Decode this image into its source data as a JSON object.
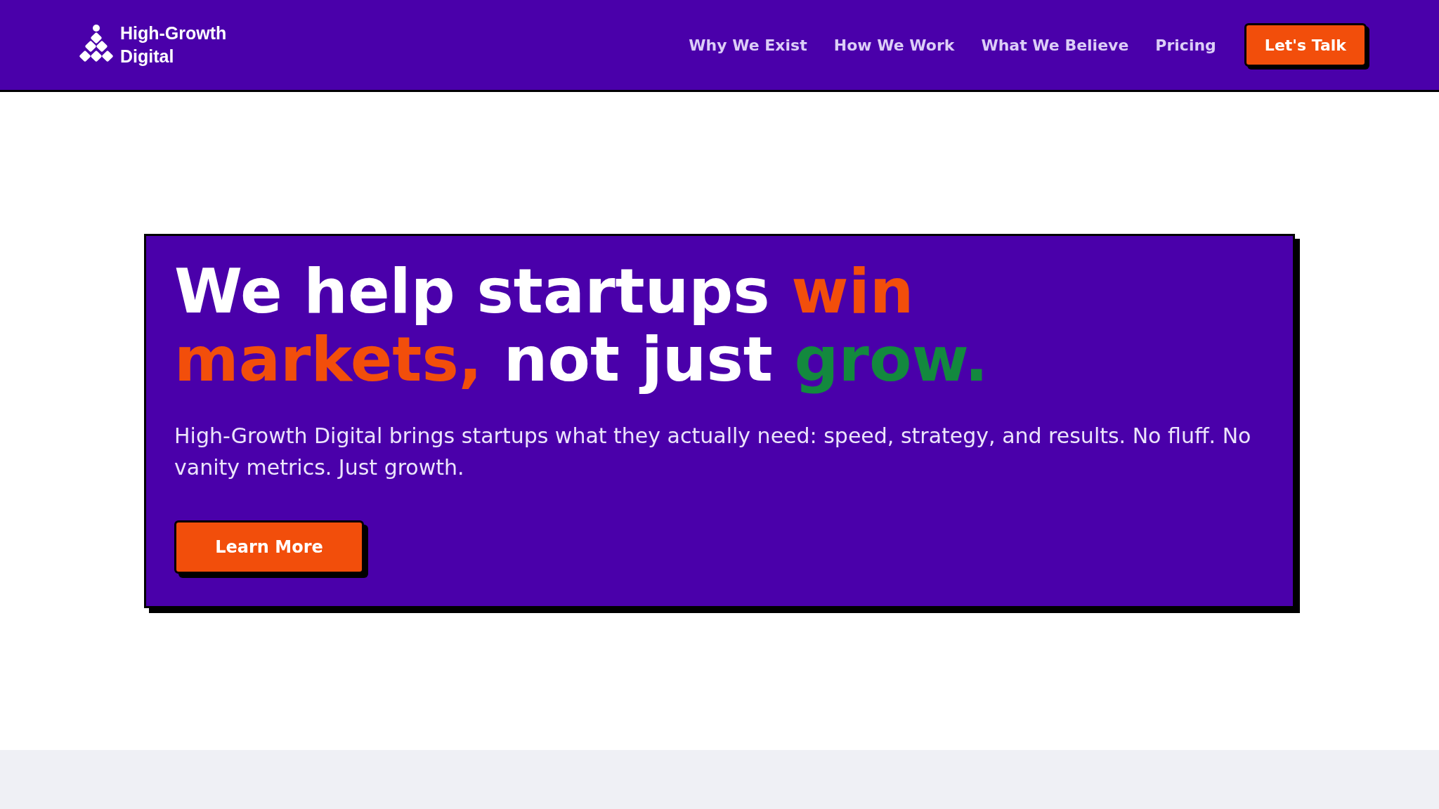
{
  "header": {
    "logo": {
      "line_1": "High-Growth",
      "line_2": "Digital"
    },
    "nav": [
      {
        "label": "Why We Exist"
      },
      {
        "label": "How We Work"
      },
      {
        "label": "What We Believe"
      },
      {
        "label": "Pricing"
      }
    ],
    "cta": "Let's Talk"
  },
  "hero": {
    "headline": [
      {
        "text": "We help startups ",
        "color": "#ffffff"
      },
      {
        "text": "win markets,",
        "color": "#f24e0b"
      },
      {
        "text": " not just ",
        "color": "#ffffff"
      },
      {
        "text": "grow.",
        "color": "#13893e"
      }
    ],
    "text": "High-Growth Digital brings startups what they actually need: speed, strategy, and results. No fluff. No vanity metrics. Just growth.",
    "button": "Learn More"
  }
}
